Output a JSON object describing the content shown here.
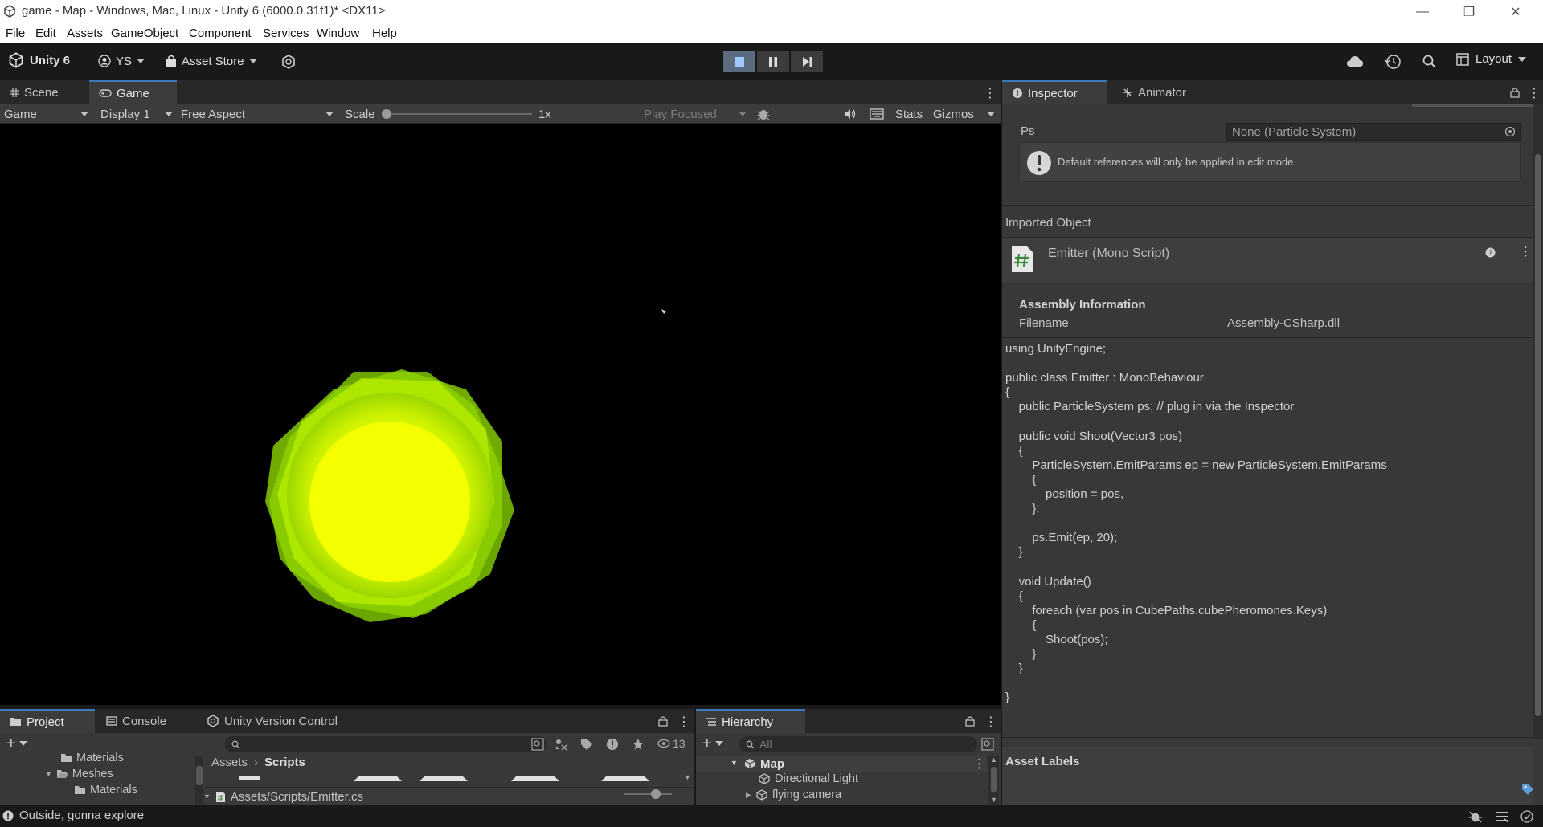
{
  "window": {
    "title": "game - Map - Windows, Mac, Linux - Unity 6 (6000.0.31f1)* <DX11>",
    "controls": [
      "—",
      "❐",
      "✕"
    ]
  },
  "menu": [
    "File",
    "Edit",
    "Assets",
    "GameObject",
    "Component",
    "Services",
    "Window",
    "Help"
  ],
  "toolbar": {
    "unity_label": "Unity 6",
    "account": "YS",
    "asset_store": "Asset Store",
    "layout": "Layout"
  },
  "scene_tabs": [
    {
      "label": "Scene",
      "active": false
    },
    {
      "label": "Game",
      "active": true
    }
  ],
  "game_bar": {
    "mode": "Game",
    "display": "Display 1",
    "aspect": "Free Aspect",
    "scale_label": "Scale",
    "scale_value": "1x",
    "play_focused": "Play Focused",
    "stats": "Stats",
    "gizmos": "Gizmos"
  },
  "inspector": {
    "tabs": [
      {
        "label": "Inspector",
        "active": true
      },
      {
        "label": "Animator",
        "active": false
      }
    ],
    "ps_label": "Ps",
    "ps_value": "None (Particle System)",
    "help_text": "Default references will only be applied in edit mode.",
    "imported_object": "Imported Object",
    "script_name": "Emitter (Mono Script)",
    "assembly_header": "Assembly Information",
    "filename_label": "Filename",
    "filename_value": "Assembly-CSharp.dll",
    "code_lines": [
      "using UnityEngine;",
      "",
      "public class Emitter : MonoBehaviour",
      "{",
      "    public ParticleSystem ps; // plug in via the Inspector",
      "",
      "    public void Shoot(Vector3 pos)",
      "    {",
      "        ParticleSystem.EmitParams ep = new ParticleSystem.EmitParams",
      "        {",
      "            position = pos,",
      "        };",
      "",
      "        ps.Emit(ep, 20);",
      "    }",
      "",
      "    void Update()",
      "    {",
      "        foreach (var pos in CubePaths.cubePheromones.Keys)",
      "        {",
      "            Shoot(pos);",
      "        }",
      "    }",
      "",
      "}"
    ],
    "asset_labels": "Asset Labels"
  },
  "project": {
    "tabs": [
      {
        "label": "Project",
        "active": true
      },
      {
        "label": "Console",
        "active": false
      },
      {
        "label": "Unity Version Control",
        "active": false
      }
    ],
    "tree": [
      "Materials",
      "Meshes",
      "Materials"
    ],
    "breadcrumb": [
      "Assets",
      "Scripts"
    ],
    "asset_path": "Assets/Scripts/Emitter.cs",
    "hidden_count": "13"
  },
  "hierarchy": {
    "tab": "Hierarchy",
    "search_placeholder": "All",
    "scene": "Map",
    "items": [
      "Directional Light",
      "flying camera"
    ]
  },
  "status": {
    "message": "Outside, gonna explore"
  },
  "colors": {
    "accent": "#3a79bb",
    "blob_core": "#f2ff00",
    "blob_edge": "#8fd400"
  }
}
